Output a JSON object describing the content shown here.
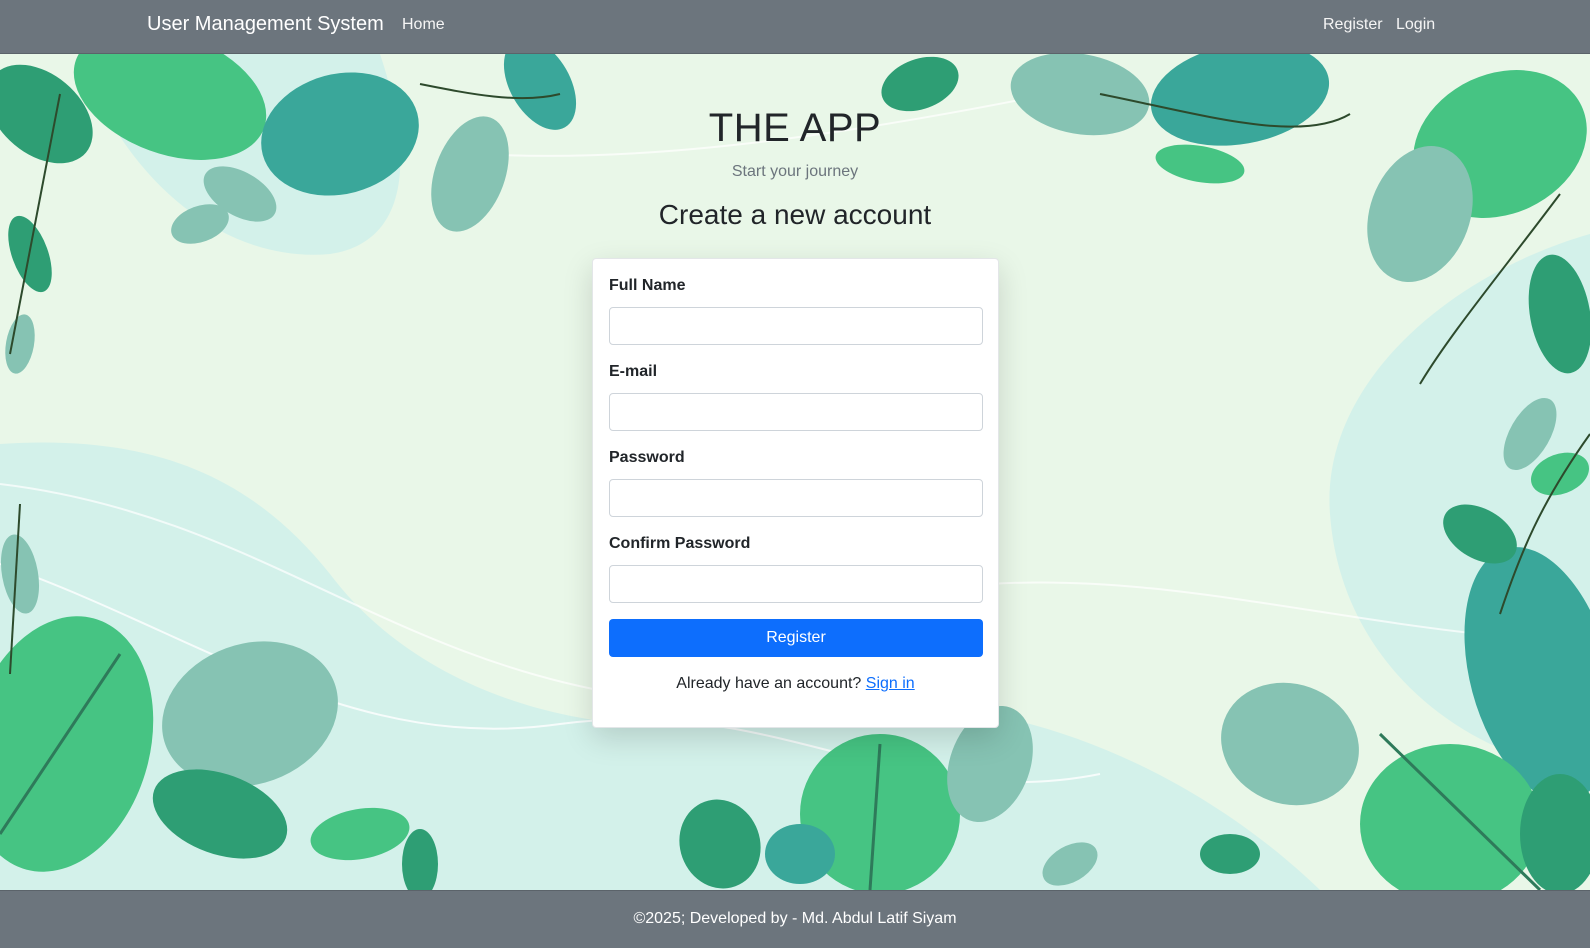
{
  "navbar": {
    "brand": "User Management System",
    "links": {
      "home": "Home",
      "register": "Register",
      "login": "Login"
    }
  },
  "hero": {
    "title": "THE APP",
    "subtitle": "Start your journey",
    "form_heading": "Create a new account"
  },
  "form": {
    "full_name_label": "Full Name",
    "full_name_value": "",
    "email_label": "E-mail",
    "email_value": "",
    "password_label": "Password",
    "password_value": "",
    "confirm_password_label": "Confirm Password",
    "confirm_password_value": "",
    "submit_label": "Register",
    "signin_prompt": "Already have an account?",
    "signin_link": "Sign in"
  },
  "footer": {
    "text": "©2025; Developed by - Md. Abdul Latif Siyam"
  },
  "colors": {
    "nav_bg": "#6c757d",
    "primary": "#0d6efd",
    "bg_light": "#e9f7e8",
    "leaf_dark": "#2e9e74",
    "leaf_mid": "#46c483",
    "leaf_teal": "#3aa79a",
    "leaf_soft": "#86c3b3"
  },
  "icons": [
    "leaf-decoration"
  ]
}
